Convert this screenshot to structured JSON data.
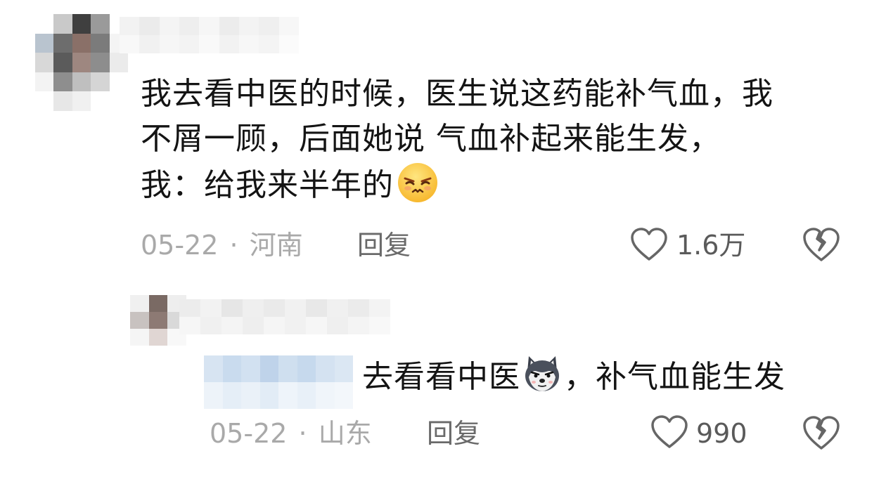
{
  "comment": {
    "lines": [
      "我去看中医的时候，医生说这药能补气血，我",
      "不屑一顾，后面她说 气血补起来能生发，",
      "我：给我来半年的"
    ],
    "emoji": "squinting-face-emoji",
    "date": "05-22",
    "separator": "·",
    "location": "河南",
    "reply_label": "回复",
    "likes": "1.6万"
  },
  "reply": {
    "text_before": "去看看中医",
    "emoji": "wolf-face-emoji",
    "text_after": "，补气血能生发",
    "date": "05-22",
    "separator": "·",
    "location": "山东",
    "reply_label": "回复",
    "likes": "990"
  },
  "icons": {
    "like": "heart-outline-icon",
    "dislike": "broken-heart-icon"
  },
  "colors": {
    "text": "#141414",
    "meta": "#a9a9a9",
    "icon": "#666666"
  }
}
